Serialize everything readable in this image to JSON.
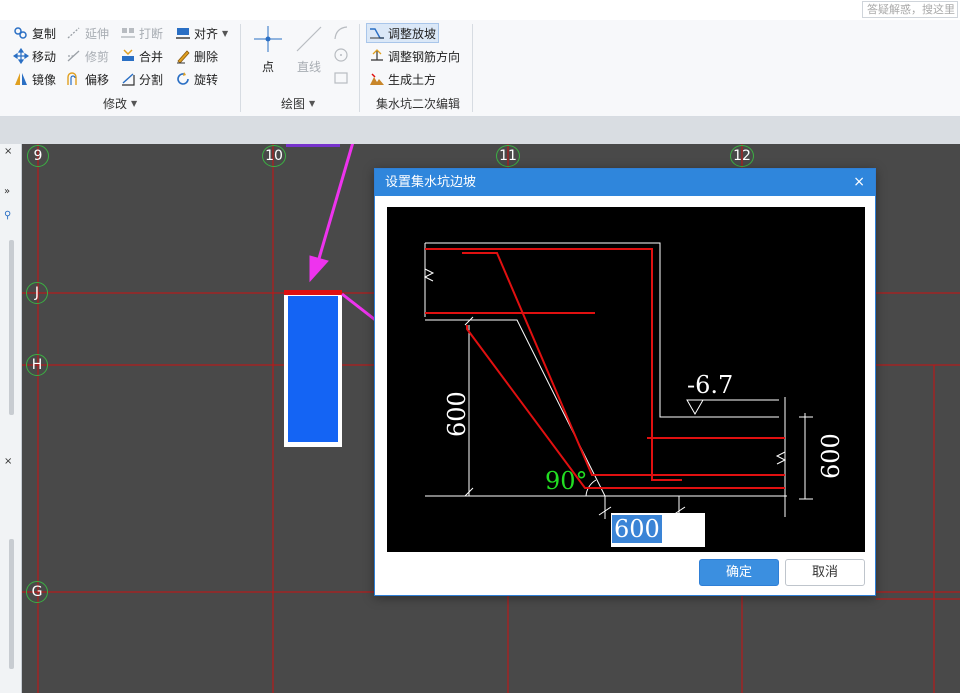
{
  "search": {
    "placeholder": "答疑解惑，搜这里"
  },
  "ribbon": {
    "modify": {
      "title": "修改",
      "tools": {
        "copy": "复制",
        "extend": "延伸",
        "break": "打断",
        "align": "对齐",
        "move": "移动",
        "trim": "修剪",
        "merge": "合并",
        "delete": "删除",
        "mirror": "镜像",
        "offset": "偏移",
        "split": "分割",
        "rotate": "旋转"
      }
    },
    "draw": {
      "title": "绘图",
      "point": "点",
      "line": "直线"
    },
    "sump": {
      "title": "集水坑二次编辑",
      "adjust_slope": "调整放坡",
      "adjust_rebar": "调整钢筋方向",
      "gen_earthwork": "生成土方"
    }
  },
  "canvas": {
    "axes_vertical": [
      "9",
      "10",
      "11",
      "12"
    ],
    "axes_horizontal": [
      "J",
      "H",
      "G"
    ]
  },
  "dialog": {
    "title": "设置集水坑边坡",
    "close": "×",
    "diagram": {
      "elevation": "-6.7",
      "depth_left": "600",
      "depth_right": "600",
      "angle": "90°",
      "width_value": "600"
    },
    "ok_label": "确定",
    "cancel_label": "取消"
  },
  "colors": {
    "accent": "#2f86dc",
    "rebar_red": "#e01010",
    "grid_red": "#d40000",
    "annotation_magenta": "#ee33ee",
    "angle_green": "#22dd22",
    "canvas_bg": "#494949",
    "element_blue": "#1464f4"
  }
}
